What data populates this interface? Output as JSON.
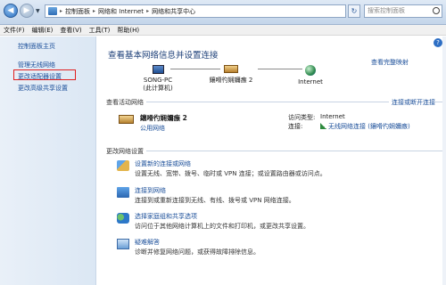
{
  "address": {
    "crumbs": [
      "控制面板",
      "网络和 Internet",
      "网络和共享中心"
    ],
    "search_placeholder": "搜索控制面板"
  },
  "menu": [
    "文件(F)",
    "编辑(E)",
    "查看(V)",
    "工具(T)",
    "帮助(H)"
  ],
  "sidebar": {
    "home": "控制面板主页",
    "items": [
      "管理无线网络",
      "更改适配器设置",
      "更改高级共享设置"
    ]
  },
  "main": {
    "title": "查看基本网络信息并设置连接",
    "full_map": "查看完整映射",
    "map": {
      "pc_name": "SONG-PC",
      "pc_sub": "(此计算机)",
      "network": "鑲嗗彴娴嬭瘯  2",
      "internet": "Internet"
    },
    "active_label": "查看活动网络",
    "disconnect": "连接或断开连接",
    "active": {
      "name": "鑲嗗彴娴嬭瘯  2",
      "type": "公用网络",
      "access_key": "访问类型:",
      "access_val": "Internet",
      "conn_key": "连接:",
      "conn_val": "无线网络连接 (鑲嗗彴娴嬭瘯)"
    },
    "change_label": "更改网络设置",
    "tasks": [
      {
        "title": "设置新的连接或网络",
        "desc": "设置无线、宽带、拨号、临时或 VPN 连接；或设置路由器或访问点。"
      },
      {
        "title": "连接到网络",
        "desc": "连接到或重新连接到无线、有线、拨号或 VPN 网络连接。"
      },
      {
        "title": "选择家庭组和共享选项",
        "desc": "访问位于其他网络计算机上的文件和打印机，或更改共享设置。"
      },
      {
        "title": "疑难解答",
        "desc": "诊断并修复网络问题，或获得故障排除信息。"
      }
    ]
  }
}
